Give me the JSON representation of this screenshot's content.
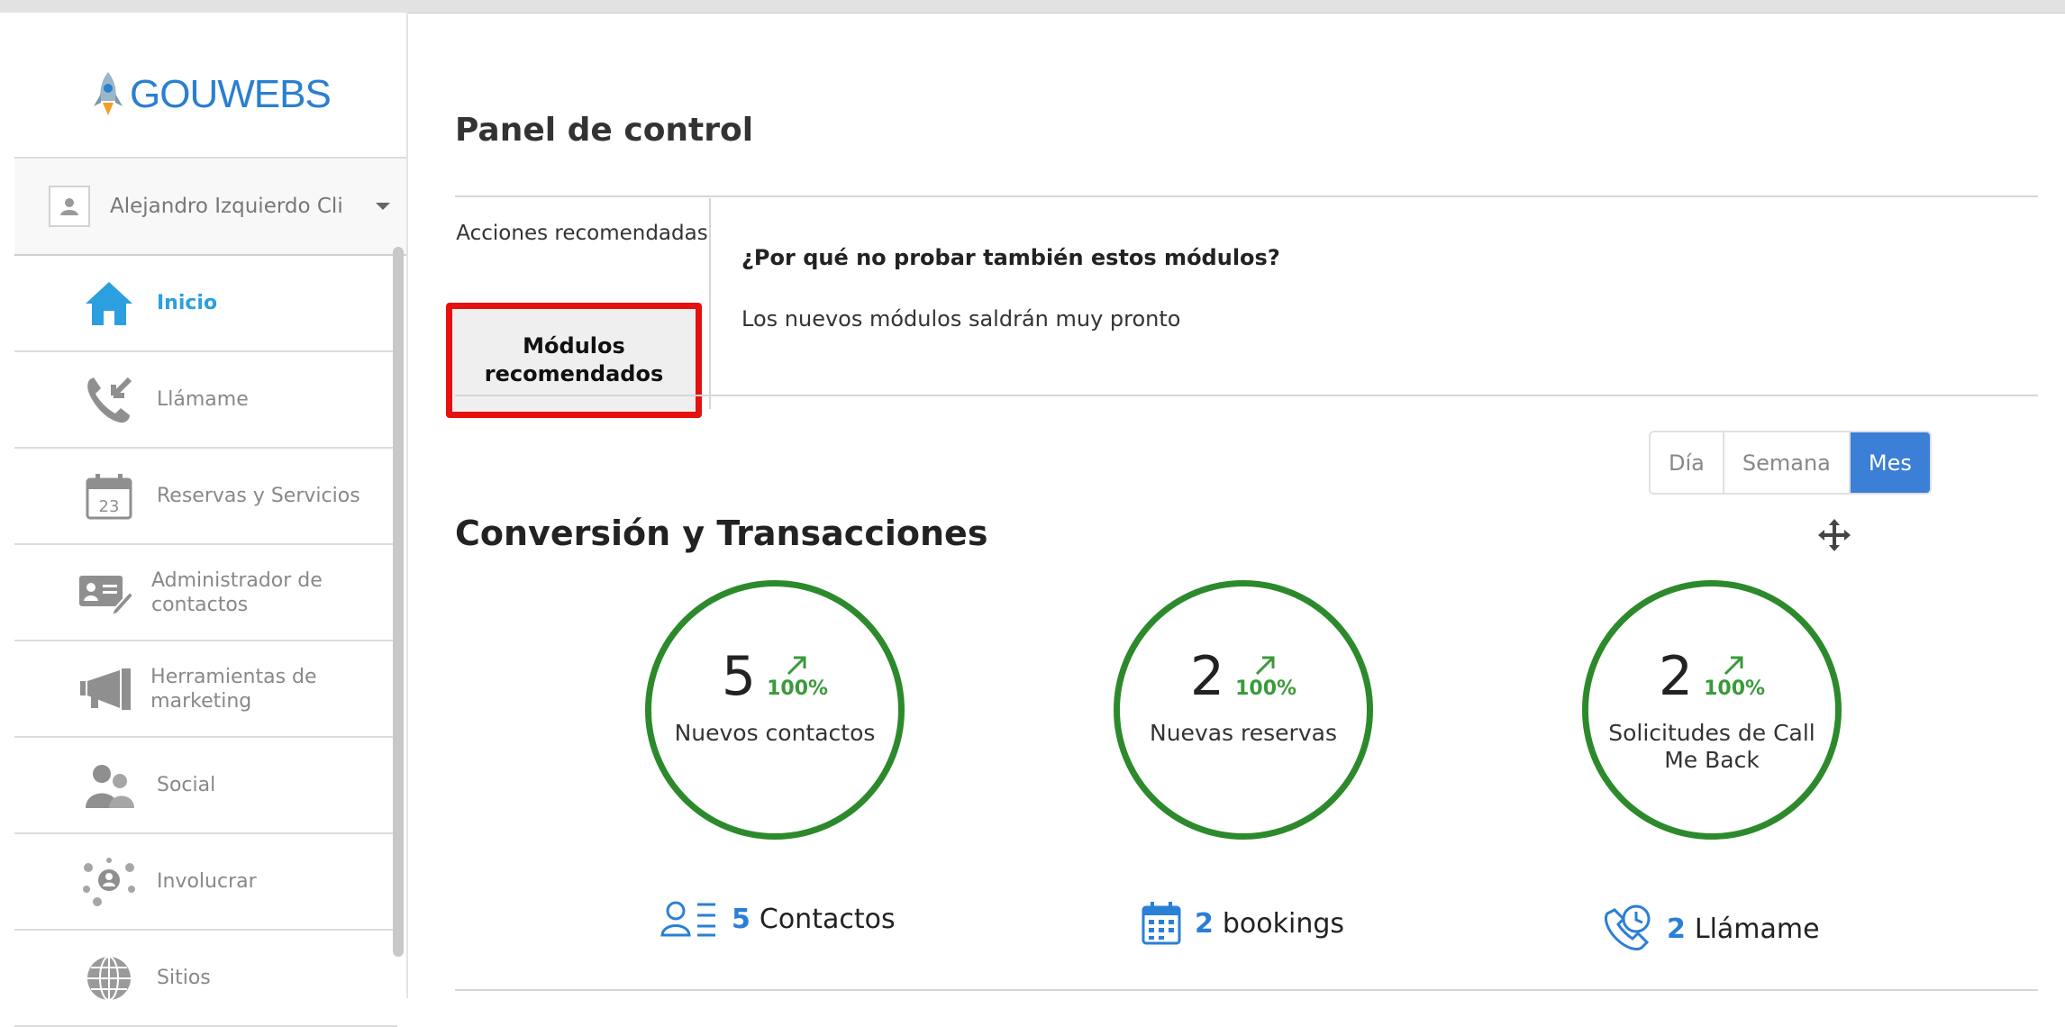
{
  "sidebar": {
    "logo_text": "GOUWEBS",
    "user_name": "Alejandro Izquierdo Cli",
    "items": [
      {
        "label": "Inicio",
        "icon": "home-icon",
        "active": true
      },
      {
        "label": "Llámame",
        "icon": "phone-icon"
      },
      {
        "label": "Reservas y Servicios",
        "icon": "calendar-icon",
        "calendar_day": "23"
      },
      {
        "label": "Administrador de contactos",
        "icon": "contact-card-icon"
      },
      {
        "label": "Herramientas de marketing",
        "icon": "megaphone-icon"
      },
      {
        "label": "Social",
        "icon": "people-icon"
      },
      {
        "label": "Involucrar",
        "icon": "network-icon"
      },
      {
        "label": "Sitios",
        "icon": "globe-icon"
      }
    ]
  },
  "main": {
    "title": "Panel de control",
    "tabs": {
      "tab1_label": "Acciones recomendadas",
      "tab2_label": "Módulos recomendados",
      "heading": "¿Por qué no probar también estos módulos?",
      "text": "Los nuevos módulos saldrán muy pronto"
    },
    "period": {
      "options": [
        "Día",
        "Semana",
        "Mes"
      ],
      "selected": "Mes"
    },
    "section_title": "Conversión y Transacciones",
    "stats": [
      {
        "value": "5",
        "change": "100%",
        "label": "Nuevos contactos"
      },
      {
        "value": "2",
        "change": "100%",
        "label": "Nuevas reservas"
      },
      {
        "value": "2",
        "change": "100%",
        "label": "Solicitudes de Call Me Back"
      }
    ],
    "summaries": [
      {
        "number": "5",
        "label": "Contactos",
        "icon": "contacts-list-icon"
      },
      {
        "number": "2",
        "label": "bookings",
        "icon": "calendar-icon"
      },
      {
        "number": "2",
        "label": "Llámame",
        "icon": "phone-clock-icon"
      }
    ]
  },
  "colors": {
    "accent": "#2a7fd6",
    "active_nav": "#2b9fdf",
    "stat_ring": "#2c8a2c",
    "highlight": "#e51010"
  }
}
